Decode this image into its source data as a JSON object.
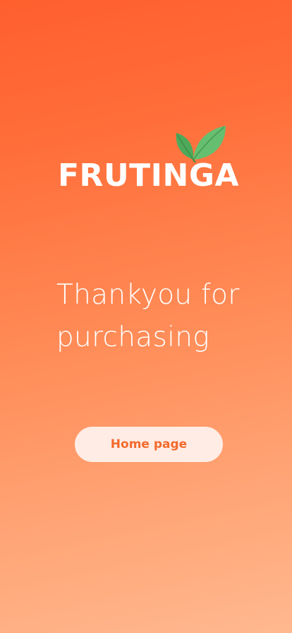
{
  "brand": {
    "name": "FRUTINGA",
    "logo_icon": "leaf-icon",
    "leaf_color": "#5fbf6a"
  },
  "message": {
    "line1": "Thankyou for",
    "line2": "purchasing"
  },
  "actions": {
    "home_label": "Home page"
  },
  "colors": {
    "background_top": "#ff5f2e",
    "background_bottom": "#ffb88f",
    "button_bg": "#ffece5",
    "button_text": "#f26a2c"
  }
}
